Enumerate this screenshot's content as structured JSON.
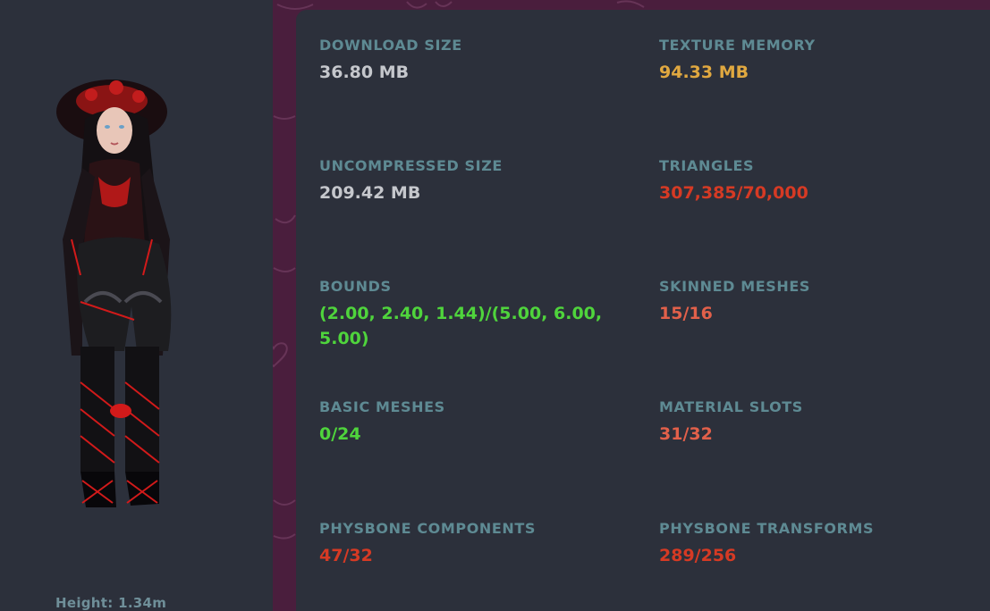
{
  "avatar": {
    "height_label": "Height: 1.34m"
  },
  "stats": [
    {
      "label": "DOWNLOAD SIZE",
      "value": "36.80 MB",
      "status": "neutral"
    },
    {
      "label": "TEXTURE MEMORY",
      "value": "94.33 MB",
      "status": "warn"
    },
    {
      "label": "UNCOMPRESSED SIZE",
      "value": "209.42 MB",
      "status": "neutral"
    },
    {
      "label": "TRIANGLES",
      "value": "307,385/70,000",
      "status": "bad"
    },
    {
      "label": "BOUNDS",
      "value": "(2.00, 2.40, 1.44)/(5.00, 6.00, 5.00)",
      "status": "good"
    },
    {
      "label": "SKINNED MESHES",
      "value": "15/16",
      "status": "badsoft"
    },
    {
      "label": "BASIC MESHES",
      "value": "0/24",
      "status": "good"
    },
    {
      "label": "MATERIAL SLOTS",
      "value": "31/32",
      "status": "badsoft"
    },
    {
      "label": "PHYSBONE COMPONENTS",
      "value": "47/32",
      "status": "bad"
    },
    {
      "label": "PHYSBONE TRANSFORMS",
      "value": "289/256",
      "status": "bad"
    }
  ],
  "colors": {
    "background": "#4a1e3d",
    "panel": "#2c303b",
    "label": "#5e8a93",
    "neutral": "#c5c7cc",
    "warn": "#e0a840",
    "bad": "#d63a24",
    "badsoft": "#e2604a",
    "good": "#4fd43c"
  }
}
